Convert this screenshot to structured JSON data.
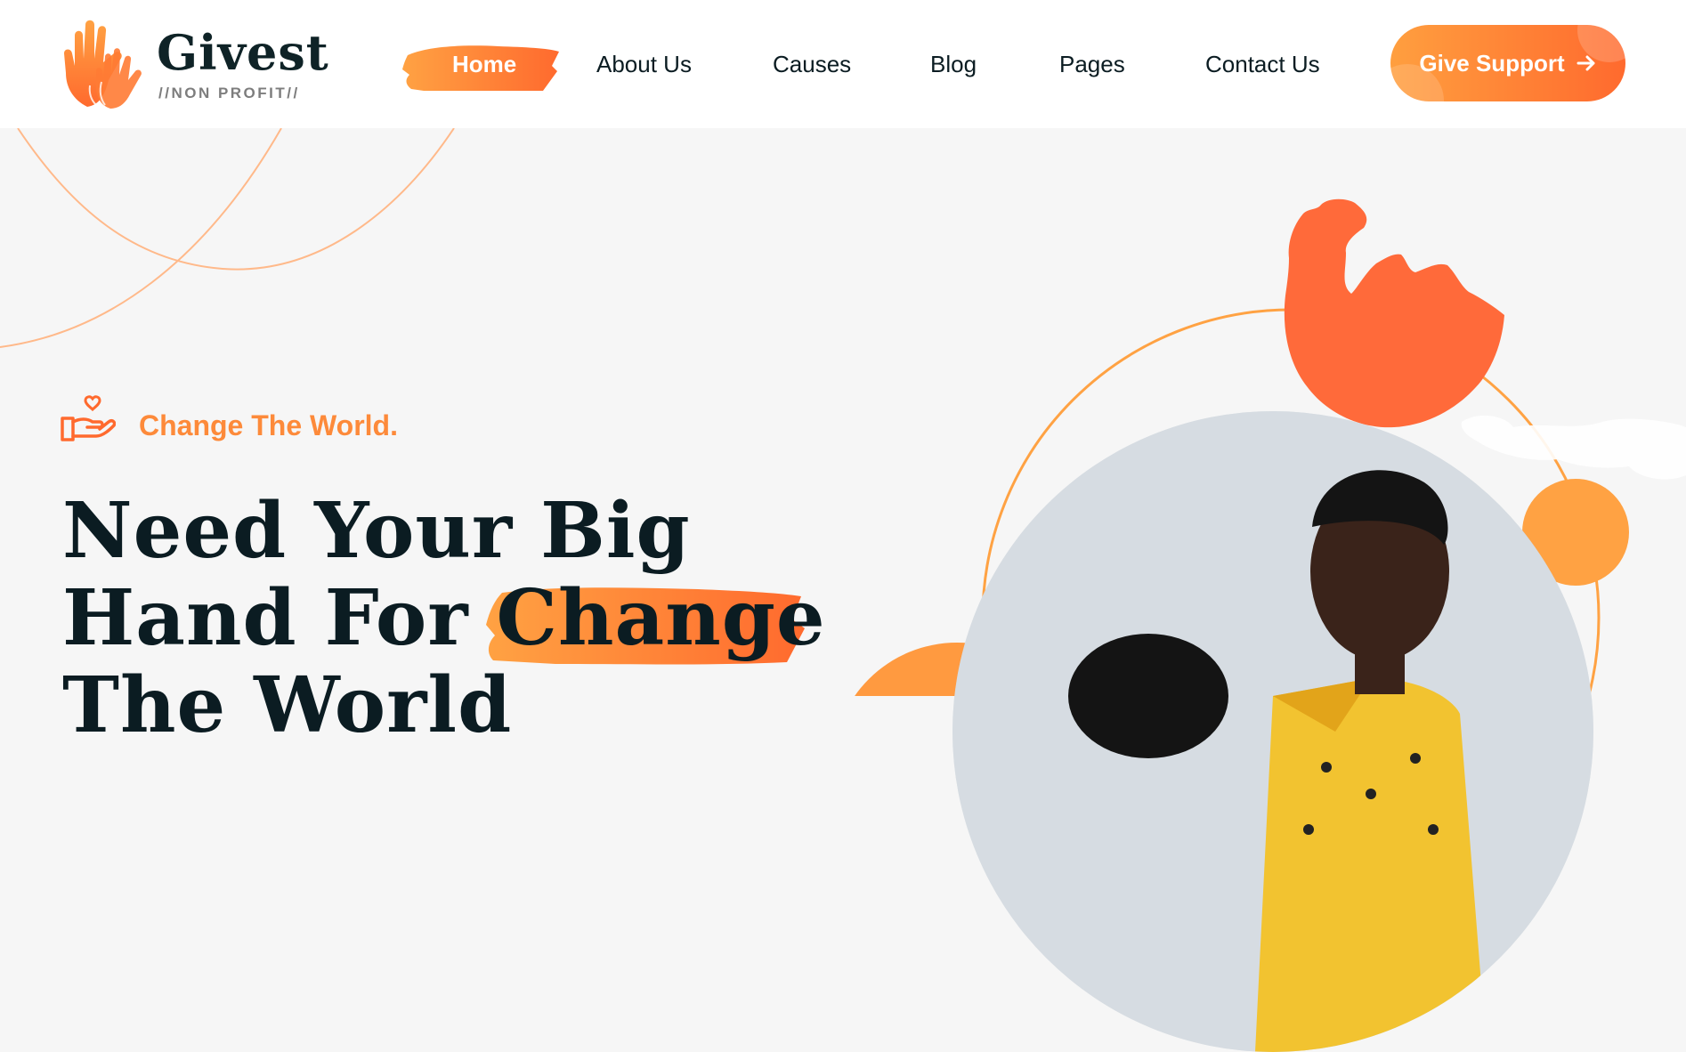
{
  "brand": {
    "name": "Givest",
    "tagline": "//NON PROFIT//",
    "logo_icon": "raised-hands-icon"
  },
  "nav": {
    "items": [
      {
        "label": "Home",
        "active": true
      },
      {
        "label": "About Us",
        "active": false
      },
      {
        "label": "Causes",
        "active": false
      },
      {
        "label": "Blog",
        "active": false
      },
      {
        "label": "Pages",
        "active": false
      },
      {
        "label": "Contact Us",
        "active": false
      }
    ],
    "cta_label": "Give Support",
    "cta_icon": "arrow-right-icon"
  },
  "hero": {
    "eyebrow": "Change The World.",
    "eyebrow_icon": "hand-with-heart-icon",
    "headline_line1": "Need Your Big",
    "headline_line2_prefix": "Hand For ",
    "headline_highlight": "Change",
    "headline_line3": "The World"
  },
  "colors": {
    "accent": "#ff6a2e",
    "accent_light": "#ffa243",
    "dark": "#0b1c22",
    "background": "#f6f6f6"
  }
}
